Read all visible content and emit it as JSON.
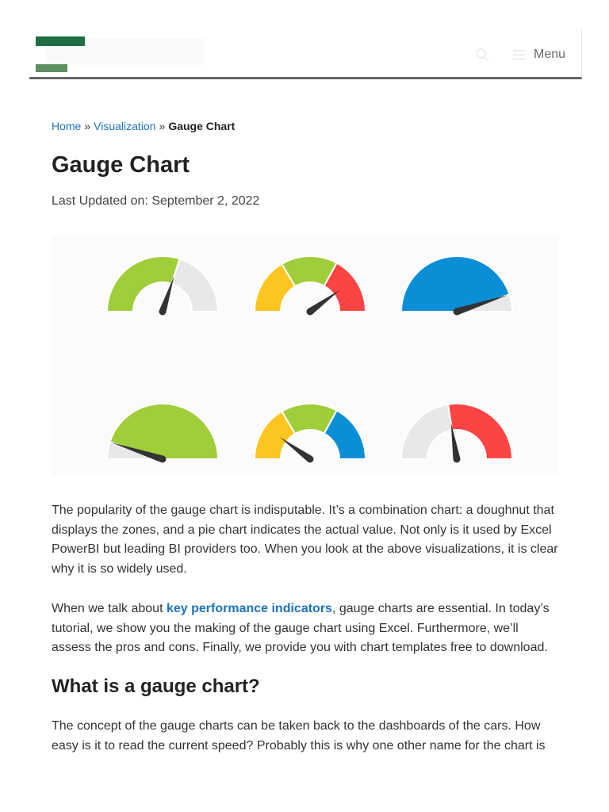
{
  "header": {
    "menu_label": "Menu",
    "brand_colors": {
      "dark": "#1f6e43",
      "light": "#5e8f62"
    }
  },
  "breadcrumb": {
    "home": "Home",
    "separator": "»",
    "section": "Visualization",
    "current": "Gauge Chart"
  },
  "article": {
    "title": "Gauge Chart",
    "last_updated": "Last Updated on: September 2, 2022",
    "p1": "The popularity of the gauge chart is indisputable. It’s a combination chart: a doughnut that displays the zones, and a pie chart indicates the actual value. Not only is it used by Excel PowerBI but leading BI providers too. When you look at the above visualizations, it is clear why it is so widely used.",
    "p2_before": "When we talk about ",
    "p2_link": "key performance indicators",
    "p2_after": ", gauge charts are essential. In today’s tutorial, we show you the making of the gauge chart using Excel. Furthermore, we’ll assess the pros and cons. Finally, we provide you with chart templates free to download.",
    "h2": "What is a gauge chart?",
    "p3": "The concept of the gauge charts can be taken back to the dashboards of the cars. How easy is it to read the current speed? Probably this is why one other name for the chart is"
  },
  "colors": {
    "green": "#a0cd3a",
    "yellow": "#fdc51f",
    "red": "#fb4444",
    "blue": "#0a8fd6",
    "gray": "#e8e8e8",
    "needle": "#333333",
    "link": "#1e73be"
  },
  "chart_data": {
    "type": "gauge",
    "gauges": [
      {
        "style": "donut",
        "zones": [
          {
            "color": "green",
            "from": 0,
            "to": 0.6
          },
          {
            "color": "gray",
            "from": 0.6,
            "to": 1
          }
        ],
        "needle": 0.6
      },
      {
        "style": "donut",
        "zones": [
          {
            "color": "yellow",
            "from": 0,
            "to": 0.33
          },
          {
            "color": "green",
            "from": 0.33,
            "to": 0.66
          },
          {
            "color": "red",
            "from": 0.66,
            "to": 1
          }
        ],
        "needle": 0.8
      },
      {
        "style": "pie",
        "zones": [
          {
            "color": "blue",
            "from": 0,
            "to": 0.9
          },
          {
            "color": "gray",
            "from": 0.9,
            "to": 1
          }
        ],
        "needle": 0.9
      },
      {
        "style": "pie",
        "zones": [
          {
            "color": "gray",
            "from": 0,
            "to": 0.1
          },
          {
            "color": "green",
            "from": 0.1,
            "to": 1
          }
        ],
        "needle": 0.1
      },
      {
        "style": "donut",
        "zones": [
          {
            "color": "yellow",
            "from": 0,
            "to": 0.33
          },
          {
            "color": "green",
            "from": 0.33,
            "to": 0.66
          },
          {
            "color": "blue",
            "from": 0.66,
            "to": 1
          }
        ],
        "needle": 0.2
      },
      {
        "style": "donut",
        "zones": [
          {
            "color": "gray",
            "from": 0,
            "to": 0.45
          },
          {
            "color": "red",
            "from": 0.45,
            "to": 1
          }
        ],
        "needle": 0.45
      }
    ]
  }
}
